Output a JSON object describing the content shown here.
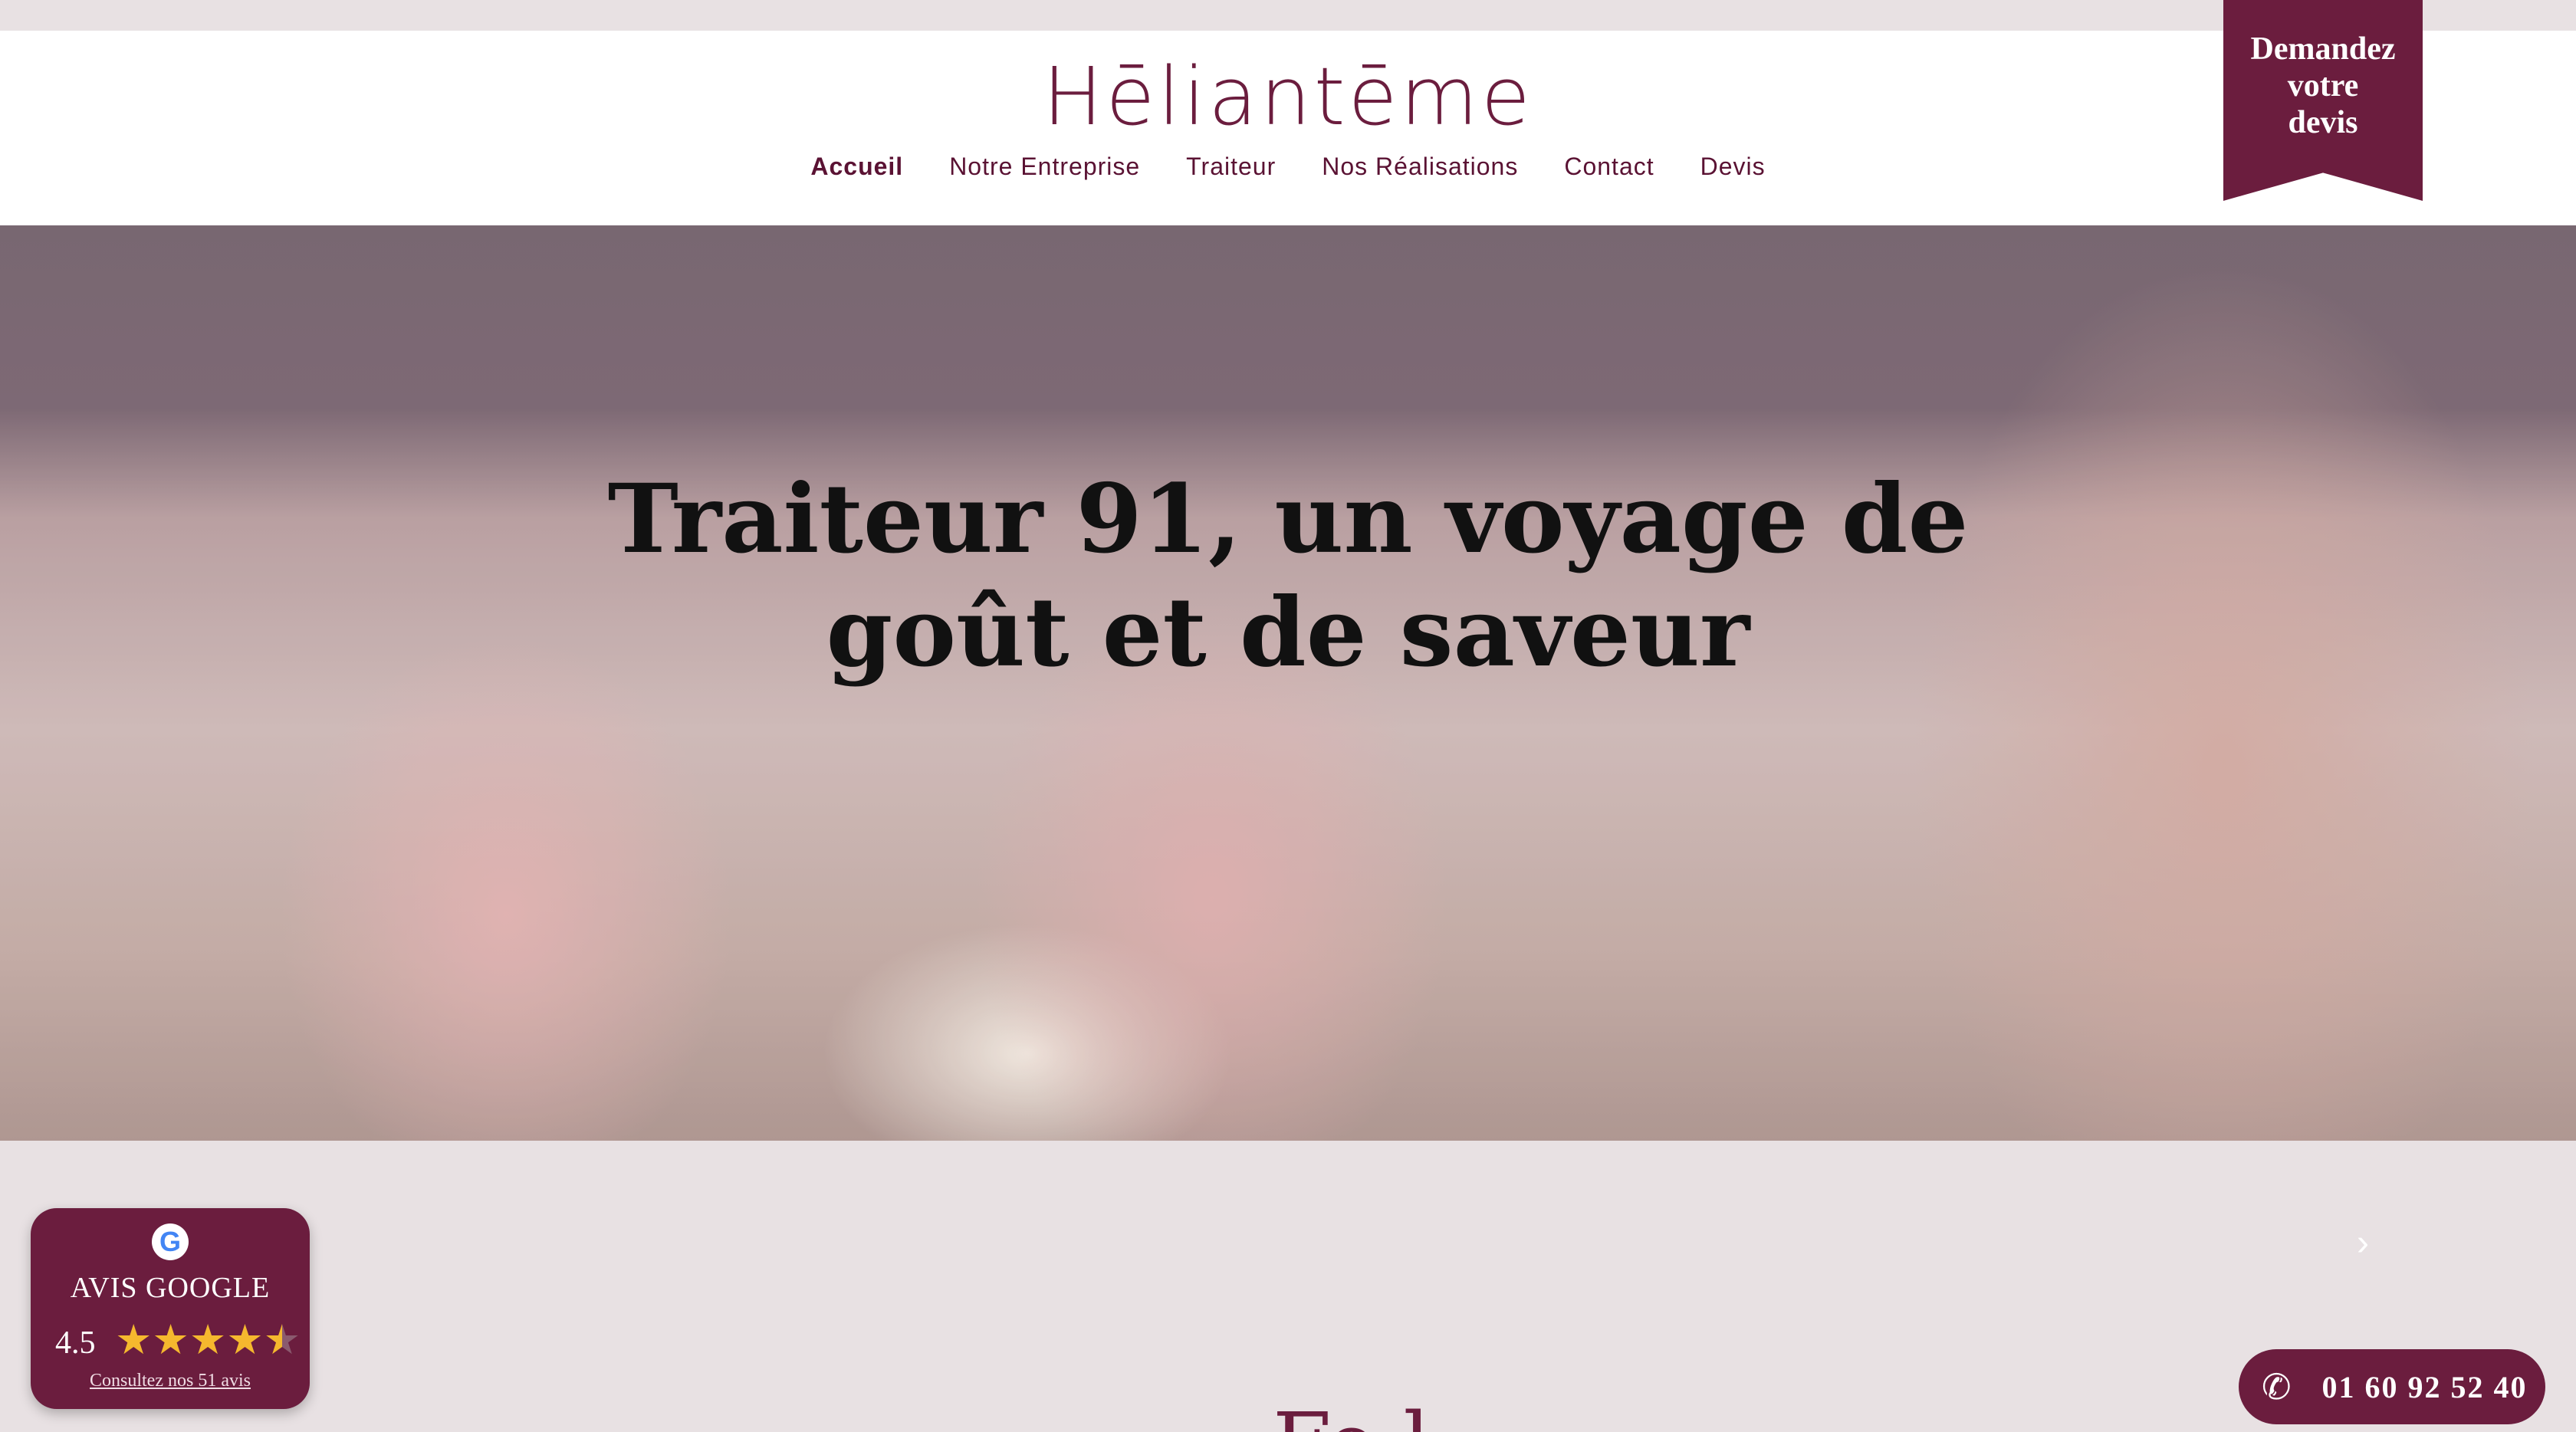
{
  "header": {
    "logo": "Hēliantēme",
    "nav": [
      {
        "label": "Accueil",
        "active": true
      },
      {
        "label": "Notre Entreprise",
        "active": false
      },
      {
        "label": "Traiteur",
        "active": false
      },
      {
        "label": "Nos Réalisations",
        "active": false
      },
      {
        "label": "Contact",
        "active": false
      },
      {
        "label": "Devis",
        "active": false
      }
    ]
  },
  "devis_banner": {
    "line1": "Demandez",
    "line2": "votre",
    "line3": "devis"
  },
  "hero": {
    "title": "Traiteur 91, un voyage de goût et de saveur"
  },
  "carousel": {
    "next_icon": "chevron-right-icon"
  },
  "google_widget": {
    "icon": "google-icon",
    "icon_glyph": "G",
    "title": "AVIS GOOGLE",
    "rating": "4.5",
    "stars": 4.5,
    "link": "Consultez nos 51 avis"
  },
  "phone": {
    "icon": "phone-icon",
    "number": "01 60 92 52 40"
  },
  "section_peek": "Fe      l",
  "colors": {
    "brand": "#6b1d3e",
    "background": "#e8e1e3",
    "star": "#f5b82e"
  }
}
